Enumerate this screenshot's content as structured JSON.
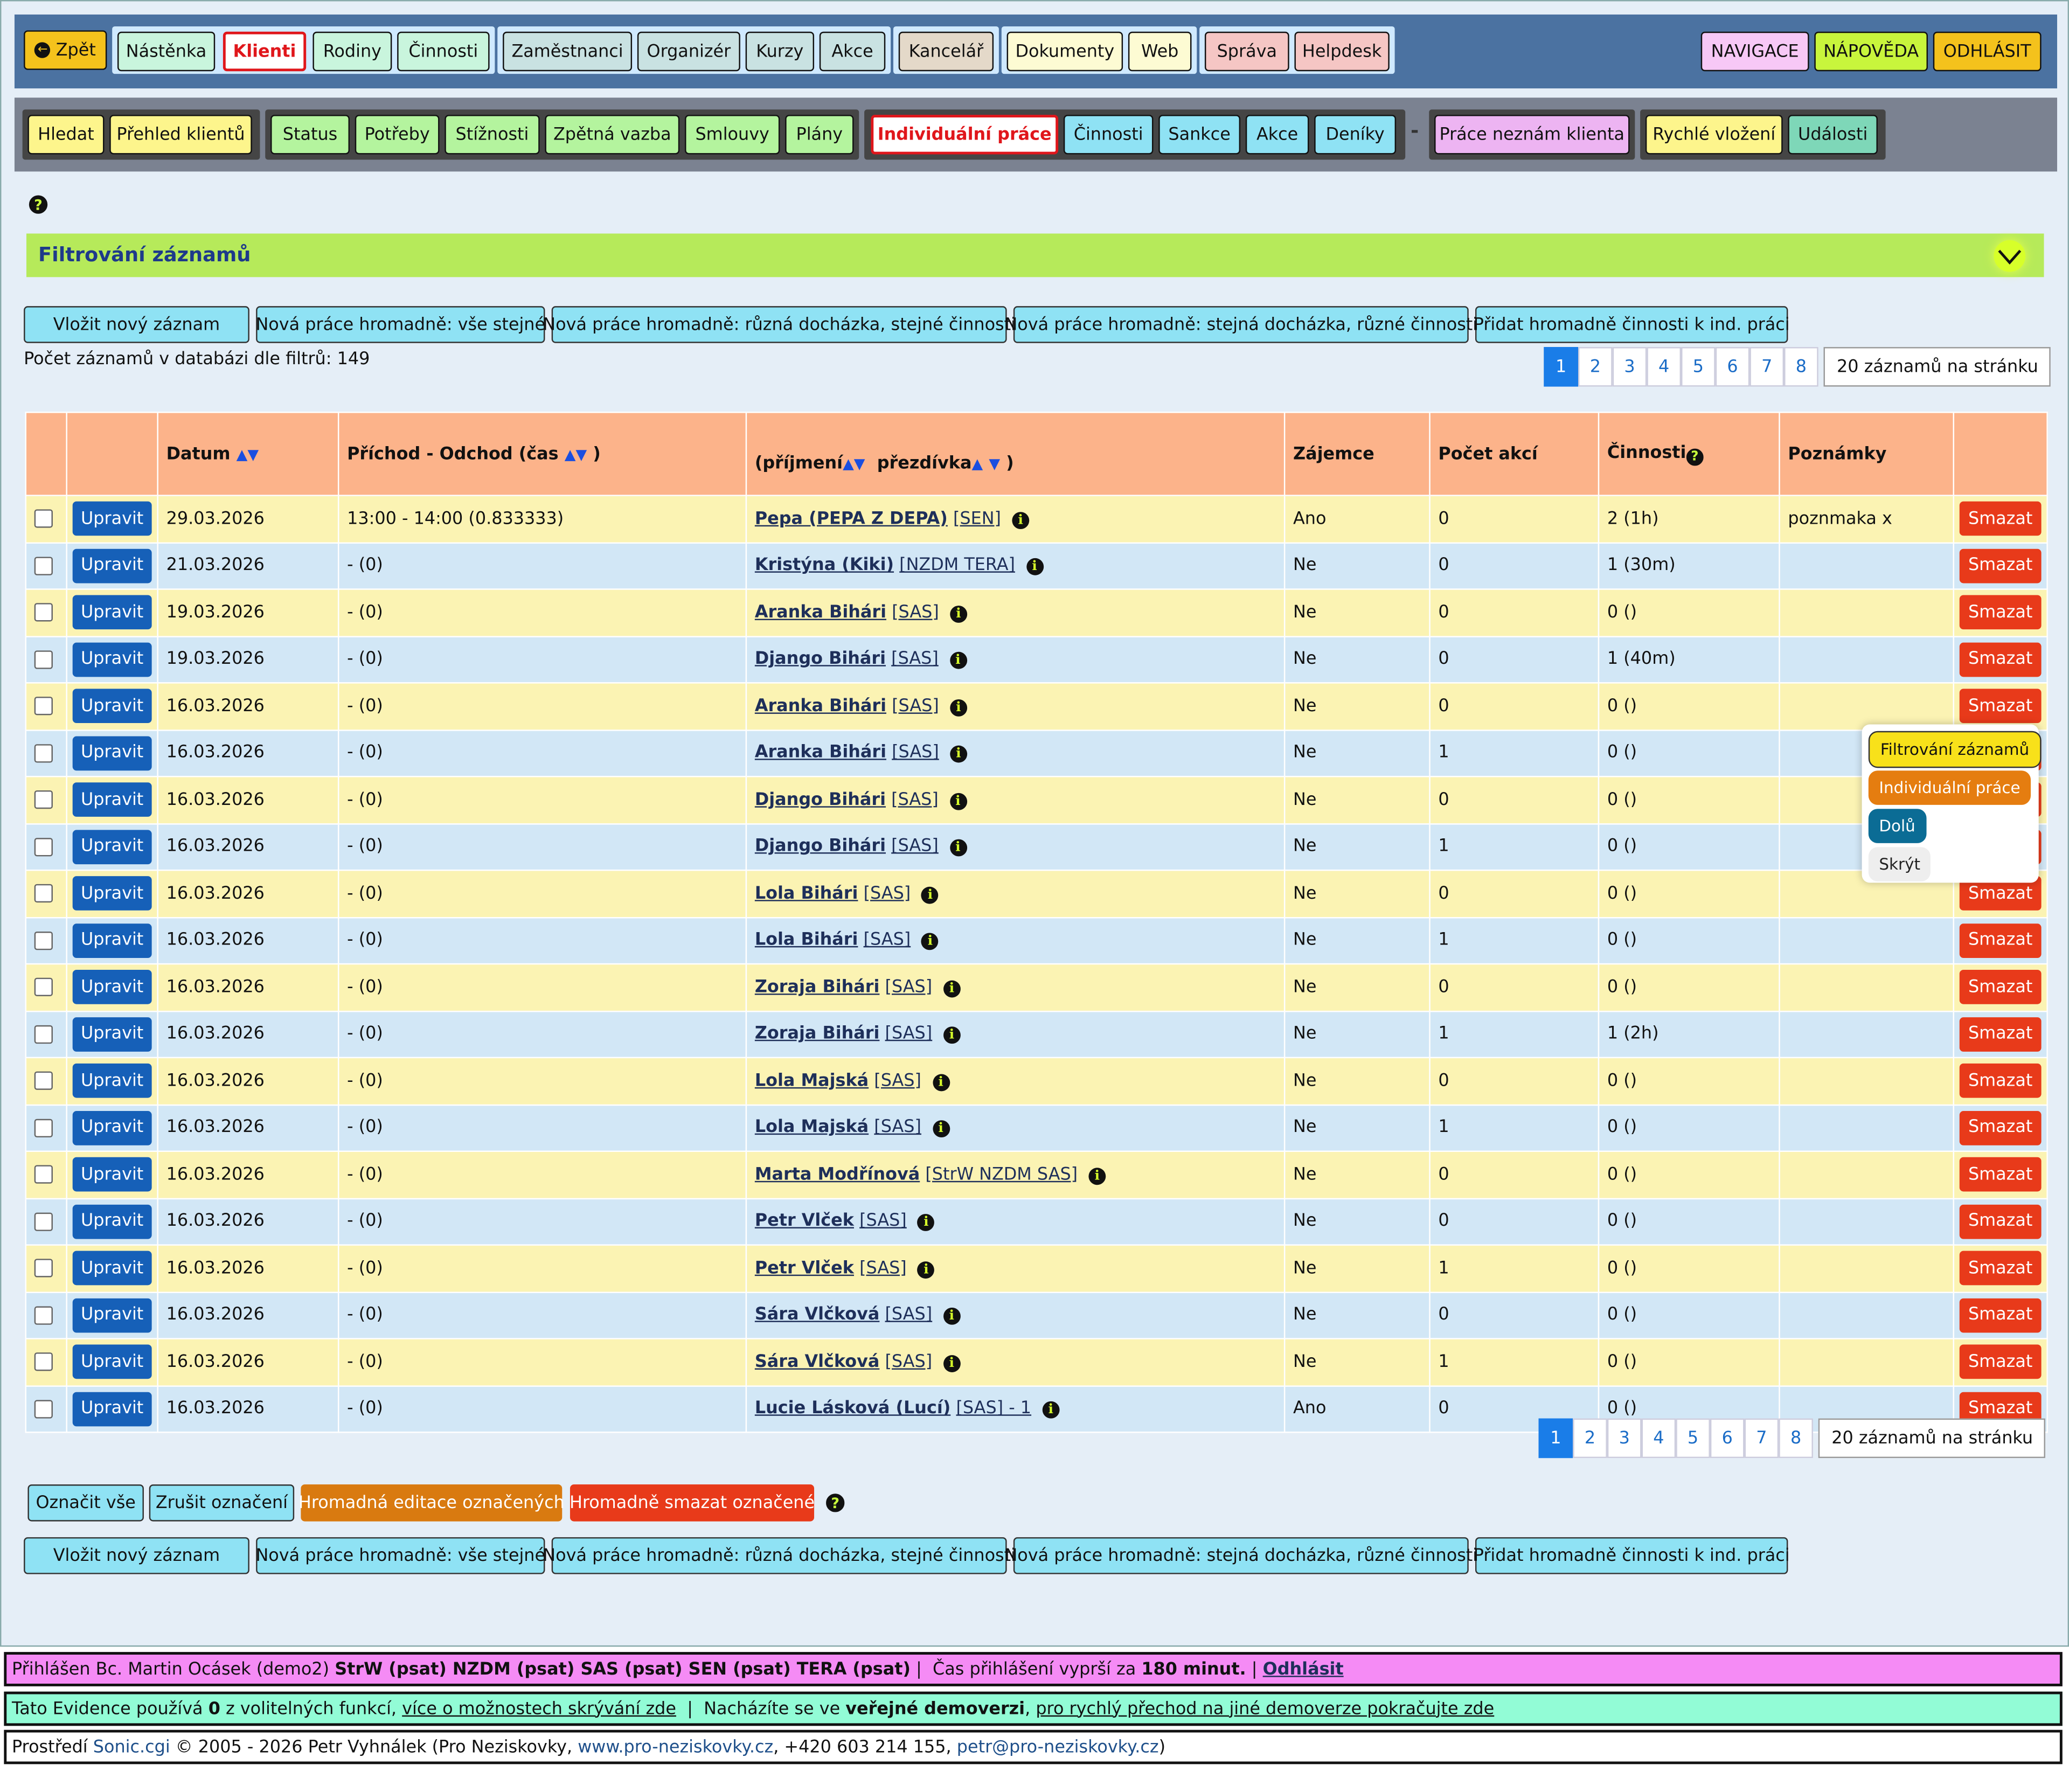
{
  "top_nav": {
    "back": "Zpět",
    "items": [
      "Nástěnka",
      "Klienti",
      "Rodiny",
      "Činnosti",
      "Zaměstnanci",
      "Organizér",
      "Kurzy",
      "Akce",
      "Kancelář",
      "Dokumenty",
      "Web",
      "Správa",
      "Helpdesk"
    ],
    "right": [
      "NAVIGACE",
      "NÁPOVĚDA",
      "ODHLÁSIT"
    ]
  },
  "sub_nav": {
    "items": [
      "Hledat",
      "Přehled klientů",
      "Status",
      "Potřeby",
      "Stížnosti",
      "Zpětná vazba",
      "Smlouvy",
      "Plány",
      "Individuální práce",
      "Činnosti",
      "Sankce",
      "Akce",
      "Deníky",
      "Práce neznám klienta",
      "Rychlé vložení",
      "Události"
    ],
    "separator": "-"
  },
  "filter": {
    "title": "Filtrování záznamů"
  },
  "action_buttons": [
    "Vložit nový záznam",
    "Nová práce hromadně: vše stejné",
    "Nová práce hromadně: různá docházka, stejné činnosti",
    "Nová práce hromadně: stejná docházka, různé činnosti",
    "Přidat hromadně činnosti k ind. práci"
  ],
  "record_count": "Počet záznamů v databázi dle filtrů: 149",
  "pagination": {
    "pages": [
      "1",
      "2",
      "3",
      "4",
      "5",
      "6",
      "7",
      "8"
    ],
    "active": "1",
    "per_page": "20 záznamů na stránku"
  },
  "table": {
    "headers": {
      "datum": "Datum",
      "prichod": "Příchod - Odchod (čas",
      "prichod_end": ")",
      "klient_open": "(příjmení",
      "klient_mid": "přezdívka",
      "klient_close": ")",
      "zajemce": "Zájemce",
      "pocet": "Počet akcí",
      "cinnosti": "Činnosti",
      "poznamky": "Poznámky"
    },
    "edit_label": "Upravit",
    "delete_label": "Smazat",
    "rows": [
      {
        "date": "29.03.2026",
        "time": "13:00 - 14:00 (0.833333)",
        "name": "Pepa (PEPA Z DEPA)",
        "group": "[SEN]",
        "zajemce": "Ano",
        "pocet": "0",
        "cinnosti": "2 (1h)",
        "poznamky": "poznmaka x"
      },
      {
        "date": "21.03.2026",
        "time": "- (0)",
        "name": "Kristýna (Kiki)",
        "group": "[NZDM TERA]",
        "zajemce": "Ne",
        "pocet": "0",
        "cinnosti": "1 (30m)",
        "poznamky": ""
      },
      {
        "date": "19.03.2026",
        "time": "- (0)",
        "name": "Aranka Bihári",
        "group": "[SAS]",
        "zajemce": "Ne",
        "pocet": "0",
        "cinnosti": "0 ()",
        "poznamky": ""
      },
      {
        "date": "19.03.2026",
        "time": "- (0)",
        "name": "Django Bihári",
        "group": "[SAS]",
        "zajemce": "Ne",
        "pocet": "0",
        "cinnosti": "1 (40m)",
        "poznamky": ""
      },
      {
        "date": "16.03.2026",
        "time": "- (0)",
        "name": "Aranka Bihári",
        "group": "[SAS]",
        "zajemce": "Ne",
        "pocet": "0",
        "cinnosti": "0 ()",
        "poznamky": ""
      },
      {
        "date": "16.03.2026",
        "time": "- (0)",
        "name": "Aranka Bihári",
        "group": "[SAS]",
        "zajemce": "Ne",
        "pocet": "1",
        "cinnosti": "0 ()",
        "poznamky": ""
      },
      {
        "date": "16.03.2026",
        "time": "- (0)",
        "name": "Django Bihári",
        "group": "[SAS]",
        "zajemce": "Ne",
        "pocet": "0",
        "cinnosti": "0 ()",
        "poznamky": ""
      },
      {
        "date": "16.03.2026",
        "time": "- (0)",
        "name": "Django Bihári",
        "group": "[SAS]",
        "zajemce": "Ne",
        "pocet": "1",
        "cinnosti": "0 ()",
        "poznamky": ""
      },
      {
        "date": "16.03.2026",
        "time": "- (0)",
        "name": "Lola Bihári",
        "group": "[SAS]",
        "zajemce": "Ne",
        "pocet": "0",
        "cinnosti": "0 ()",
        "poznamky": ""
      },
      {
        "date": "16.03.2026",
        "time": "- (0)",
        "name": "Lola Bihári",
        "group": "[SAS]",
        "zajemce": "Ne",
        "pocet": "1",
        "cinnosti": "0 ()",
        "poznamky": ""
      },
      {
        "date": "16.03.2026",
        "time": "- (0)",
        "name": "Zoraja Bihári",
        "group": "[SAS]",
        "zajemce": "Ne",
        "pocet": "0",
        "cinnosti": "0 ()",
        "poznamky": ""
      },
      {
        "date": "16.03.2026",
        "time": "- (0)",
        "name": "Zoraja Bihári",
        "group": "[SAS]",
        "zajemce": "Ne",
        "pocet": "1",
        "cinnosti": "1 (2h)",
        "poznamky": ""
      },
      {
        "date": "16.03.2026",
        "time": "- (0)",
        "name": "Lola Majská",
        "group": "[SAS]",
        "zajemce": "Ne",
        "pocet": "0",
        "cinnosti": "0 ()",
        "poznamky": ""
      },
      {
        "date": "16.03.2026",
        "time": "- (0)",
        "name": "Lola Majská",
        "group": "[SAS]",
        "zajemce": "Ne",
        "pocet": "1",
        "cinnosti": "0 ()",
        "poznamky": ""
      },
      {
        "date": "16.03.2026",
        "time": "- (0)",
        "name": "Marta Modřínová",
        "group": "[StrW NZDM SAS]",
        "zajemce": "Ne",
        "pocet": "0",
        "cinnosti": "0 ()",
        "poznamky": ""
      },
      {
        "date": "16.03.2026",
        "time": "- (0)",
        "name": "Petr Vlček",
        "group": "[SAS]",
        "zajemce": "Ne",
        "pocet": "0",
        "cinnosti": "0 ()",
        "poznamky": ""
      },
      {
        "date": "16.03.2026",
        "time": "- (0)",
        "name": "Petr Vlček",
        "group": "[SAS]",
        "zajemce": "Ne",
        "pocet": "1",
        "cinnosti": "0 ()",
        "poznamky": ""
      },
      {
        "date": "16.03.2026",
        "time": "- (0)",
        "name": "Sára Vlčková",
        "group": "[SAS]",
        "zajemce": "Ne",
        "pocet": "0",
        "cinnosti": "0 ()",
        "poznamky": ""
      },
      {
        "date": "16.03.2026",
        "time": "- (0)",
        "name": "Sára Vlčková",
        "group": "[SAS]",
        "zajemce": "Ne",
        "pocet": "1",
        "cinnosti": "0 ()",
        "poznamky": ""
      },
      {
        "date": "16.03.2026",
        "time": "- (0)",
        "name": "Lucie Lásková (Lucí)",
        "group": "[SAS] - 1",
        "zajemce": "Ano",
        "pocet": "0",
        "cinnosti": "0 ()",
        "poznamky": ""
      }
    ]
  },
  "bulk": [
    "Označit vše",
    "Zrušit označení",
    "Hromadná editace označených",
    "Hromadně smazat označené"
  ],
  "float_menu": [
    "Filtrování záznamů",
    "Individuální práce",
    "Dolů",
    "Skrýt"
  ],
  "footer": {
    "login": {
      "prefix": "Přihlášen Bc. Martin Ocásek (demo2) ",
      "roles": "StrW (psat) NZDM (psat) SAS (psat) SEN (psat) TERA (psat)",
      "expiry": " |  Čas přihlášení vyprší za ",
      "minutes": "180 minut.",
      "sep": " | ",
      "logout": "Odhlásit"
    },
    "info": {
      "t1": "Tato Evidence používá ",
      "n": "0",
      "t2": " z volitelných funkcí, ",
      "link1": "více o možnostech skrývání zde",
      "t3": "  |  Nacházíte se ve ",
      "bold": "veřejné demoverzi",
      "t4": ", ",
      "link2": "pro rychlý přechod na jiné demoverze pokračujte zde"
    },
    "copyright": {
      "t1": "Prostředí ",
      "sonic": "Sonic.cgi",
      "t2": " © 2005 - 2026 Petr Vyhnálek (Pro Neziskovky, ",
      "web": "www.pro-neziskovky.cz",
      "t3": ", +420 603 214 155, ",
      "mail": "petr@pro-neziskovky.cz",
      "t4": ")"
    }
  },
  "colors": {
    "accent": "#1a7de8",
    "delete": "#e83a1a",
    "edit": "#1660b8",
    "row_yellow": "#fbf3b3",
    "row_blue": "#d2e7f6",
    "header": "#fcb38a"
  }
}
